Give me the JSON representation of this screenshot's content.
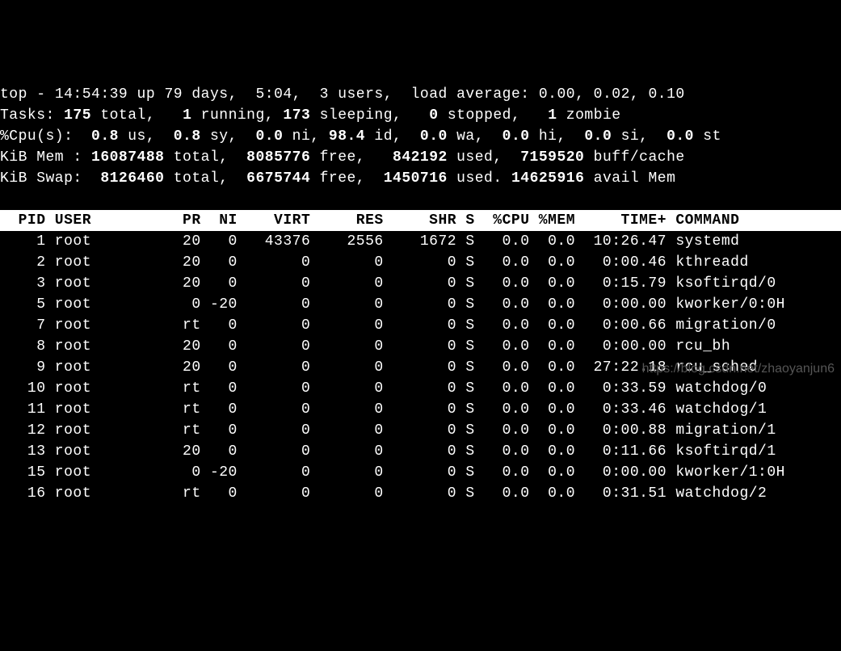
{
  "summary": {
    "line1": {
      "prefix": "top - ",
      "time": "14:54:39",
      "up_label": " up ",
      "uptime": "79 days,  5:04,  ",
      "users": "3 users,  ",
      "load_label": "load average: ",
      "load": "0.00, 0.02, 0.10"
    },
    "tasks": {
      "label": "Tasks: ",
      "total": "175",
      "total_label": " total,   ",
      "running": "1",
      "running_label": " running, ",
      "sleeping": "173",
      "sleeping_label": " sleeping,   ",
      "stopped": "0",
      "stopped_label": " stopped,   ",
      "zombie": "1",
      "zombie_label": " zombie"
    },
    "cpu": {
      "label": "%Cpu(s):  ",
      "us": "0.8",
      "us_label": " us,  ",
      "sy": "0.8",
      "sy_label": " sy,  ",
      "ni": "0.0",
      "ni_label": " ni, ",
      "id": "98.4",
      "id_label": " id,  ",
      "wa": "0.0",
      "wa_label": " wa,  ",
      "hi": "0.0",
      "hi_label": " hi,  ",
      "si": "0.0",
      "si_label": " si,  ",
      "st": "0.0",
      "st_label": " st"
    },
    "mem": {
      "label": "KiB Mem : ",
      "total": "16087488",
      "total_label": " total,  ",
      "free": "8085776",
      "free_label": " free,   ",
      "used": "842192",
      "used_label": " used,  ",
      "buff": "7159520",
      "buff_label": " buff/cache"
    },
    "swap": {
      "label": "KiB Swap:  ",
      "total": "8126460",
      "total_label": " total,  ",
      "free": "6675744",
      "free_label": " free,  ",
      "used": "1450716",
      "used_label": " used. ",
      "avail": "14625916",
      "avail_label": " avail Mem"
    }
  },
  "columns": {
    "pid": "PID",
    "user": "USER",
    "pr": "PR",
    "ni": "NI",
    "virt": "VIRT",
    "res": "RES",
    "shr": "SHR",
    "s": "S",
    "cpu": "%CPU",
    "mem": "%MEM",
    "time": "TIME+",
    "command": "COMMAND"
  },
  "procs": [
    {
      "pid": "1",
      "user": "root",
      "pr": "20",
      "ni": "0",
      "virt": "43376",
      "res": "2556",
      "shr": "1672",
      "s": "S",
      "cpu": "0.0",
      "mem": "0.0",
      "time": "10:26.47",
      "command": "systemd"
    },
    {
      "pid": "2",
      "user": "root",
      "pr": "20",
      "ni": "0",
      "virt": "0",
      "res": "0",
      "shr": "0",
      "s": "S",
      "cpu": "0.0",
      "mem": "0.0",
      "time": "0:00.46",
      "command": "kthreadd"
    },
    {
      "pid": "3",
      "user": "root",
      "pr": "20",
      "ni": "0",
      "virt": "0",
      "res": "0",
      "shr": "0",
      "s": "S",
      "cpu": "0.0",
      "mem": "0.0",
      "time": "0:15.79",
      "command": "ksoftirqd/0"
    },
    {
      "pid": "5",
      "user": "root",
      "pr": "0",
      "ni": "-20",
      "virt": "0",
      "res": "0",
      "shr": "0",
      "s": "S",
      "cpu": "0.0",
      "mem": "0.0",
      "time": "0:00.00",
      "command": "kworker/0:0H"
    },
    {
      "pid": "7",
      "user": "root",
      "pr": "rt",
      "ni": "0",
      "virt": "0",
      "res": "0",
      "shr": "0",
      "s": "S",
      "cpu": "0.0",
      "mem": "0.0",
      "time": "0:00.66",
      "command": "migration/0"
    },
    {
      "pid": "8",
      "user": "root",
      "pr": "20",
      "ni": "0",
      "virt": "0",
      "res": "0",
      "shr": "0",
      "s": "S",
      "cpu": "0.0",
      "mem": "0.0",
      "time": "0:00.00",
      "command": "rcu_bh"
    },
    {
      "pid": "9",
      "user": "root",
      "pr": "20",
      "ni": "0",
      "virt": "0",
      "res": "0",
      "shr": "0",
      "s": "S",
      "cpu": "0.0",
      "mem": "0.0",
      "time": "27:22.18",
      "command": "rcu_sched"
    },
    {
      "pid": "10",
      "user": "root",
      "pr": "rt",
      "ni": "0",
      "virt": "0",
      "res": "0",
      "shr": "0",
      "s": "S",
      "cpu": "0.0",
      "mem": "0.0",
      "time": "0:33.59",
      "command": "watchdog/0"
    },
    {
      "pid": "11",
      "user": "root",
      "pr": "rt",
      "ni": "0",
      "virt": "0",
      "res": "0",
      "shr": "0",
      "s": "S",
      "cpu": "0.0",
      "mem": "0.0",
      "time": "0:33.46",
      "command": "watchdog/1"
    },
    {
      "pid": "12",
      "user": "root",
      "pr": "rt",
      "ni": "0",
      "virt": "0",
      "res": "0",
      "shr": "0",
      "s": "S",
      "cpu": "0.0",
      "mem": "0.0",
      "time": "0:00.88",
      "command": "migration/1"
    },
    {
      "pid": "13",
      "user": "root",
      "pr": "20",
      "ni": "0",
      "virt": "0",
      "res": "0",
      "shr": "0",
      "s": "S",
      "cpu": "0.0",
      "mem": "0.0",
      "time": "0:11.66",
      "command": "ksoftirqd/1"
    },
    {
      "pid": "15",
      "user": "root",
      "pr": "0",
      "ni": "-20",
      "virt": "0",
      "res": "0",
      "shr": "0",
      "s": "S",
      "cpu": "0.0",
      "mem": "0.0",
      "time": "0:00.00",
      "command": "kworker/1:0H"
    },
    {
      "pid": "16",
      "user": "root",
      "pr": "rt",
      "ni": "0",
      "virt": "0",
      "res": "0",
      "shr": "0",
      "s": "S",
      "cpu": "0.0",
      "mem": "0.0",
      "time": "0:31.51",
      "command": "watchdog/2"
    }
  ],
  "watermark": "https://blog.csdn.net/zhaoyanjun6"
}
